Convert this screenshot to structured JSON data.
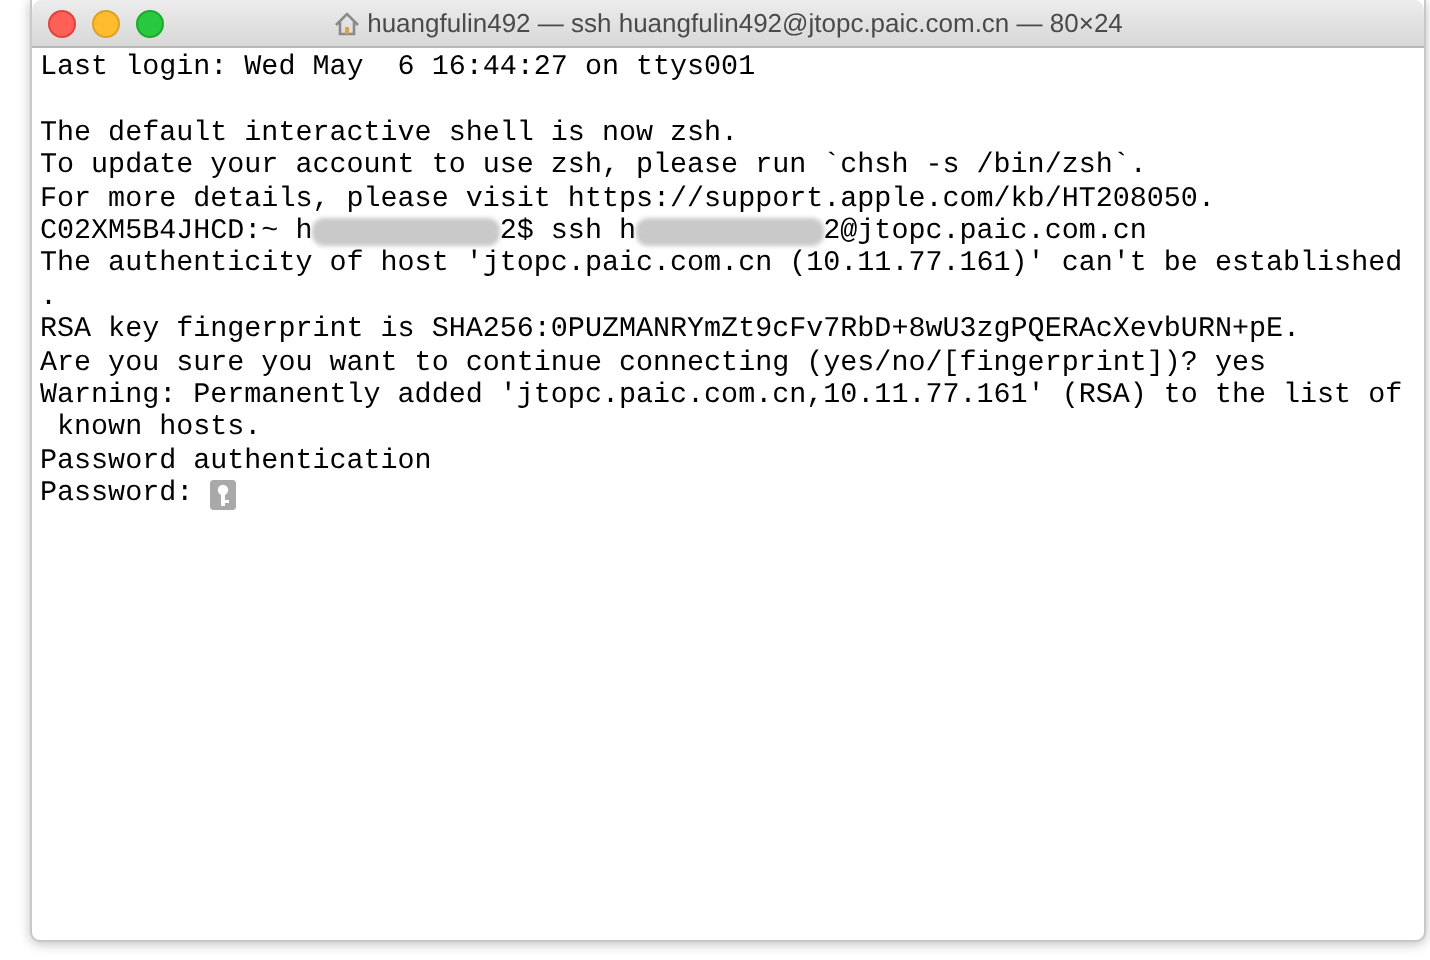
{
  "window": {
    "title": "huangfulin492 — ssh huangfulin492@jtopc.paic.com.cn — 80×24"
  },
  "lines": [
    {
      "kind": "text",
      "text": "Last login: Wed May  6 16:44:27 on ttys001"
    },
    {
      "kind": "blank"
    },
    {
      "kind": "text",
      "text": "The default interactive shell is now zsh."
    },
    {
      "kind": "text",
      "text": "To update your account to use zsh, please run `chsh -s /bin/zsh`."
    },
    {
      "kind": "text",
      "text": "For more details, please visit https://support.apple.com/kb/HT208050."
    },
    {
      "kind": "segmented",
      "segments": [
        {
          "kind": "text",
          "text": "C02XM5B4JHCD:~ h"
        },
        {
          "kind": "redacted"
        },
        {
          "kind": "text",
          "text": "2$ ssh h"
        },
        {
          "kind": "redacted"
        },
        {
          "kind": "text",
          "text": "2@jtopc.paic.com.cn"
        }
      ]
    },
    {
      "kind": "text",
      "text": "The authenticity of host 'jtopc.paic.com.cn (10.11.77.161)' can't be established"
    },
    {
      "kind": "text",
      "text": "."
    },
    {
      "kind": "text",
      "text": "RSA key fingerprint is SHA256:0PUZMANRYmZt9cFv7RbD+8wU3zgPQERAcXevbURN+pE."
    },
    {
      "kind": "text",
      "text": "Are you sure you want to continue connecting (yes/no/[fingerprint])? yes"
    },
    {
      "kind": "text",
      "text": "Warning: Permanently added 'jtopc.paic.com.cn,10.11.77.161' (RSA) to the list of"
    },
    {
      "kind": "text",
      "text": " known hosts."
    },
    {
      "kind": "text",
      "text": "Password authentication"
    },
    {
      "kind": "prompt",
      "text": "Password: "
    }
  ]
}
